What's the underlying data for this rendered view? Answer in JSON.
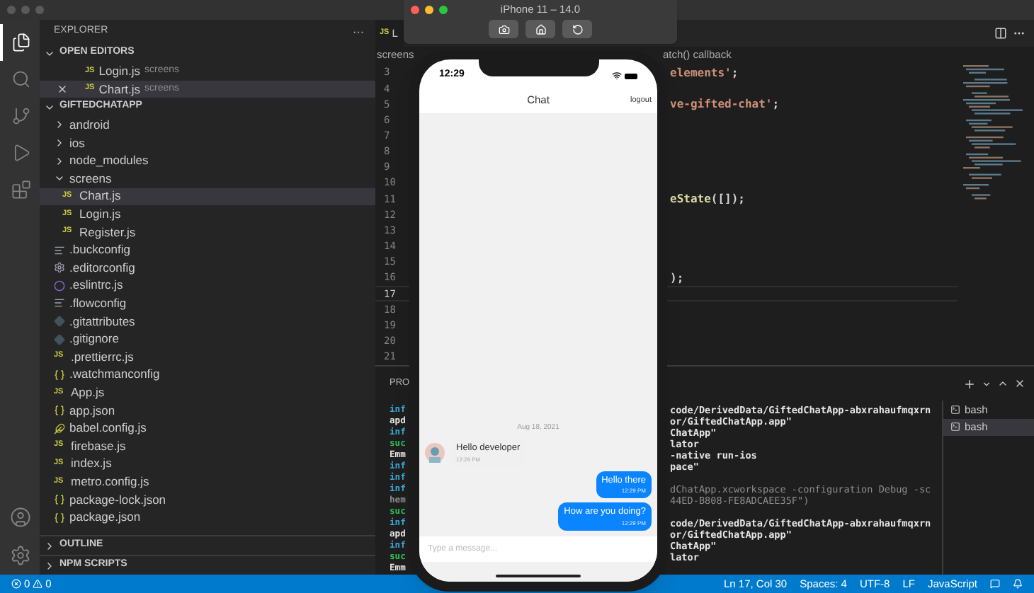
{
  "activity_bar": {
    "items": [
      {
        "kind": "files",
        "selected": true
      },
      {
        "kind": "search",
        "selected": false
      },
      {
        "kind": "git",
        "selected": false
      },
      {
        "kind": "run",
        "selected": false
      },
      {
        "kind": "extensions",
        "selected": false
      }
    ]
  },
  "sidebar": {
    "title": "EXPLORER",
    "more": "···",
    "open_editors": {
      "title": "OPEN EDITORS",
      "expanded": true,
      "items": [
        {
          "name": "Login.js",
          "folder": "screens",
          "icon_text": "JS",
          "selected": false
        },
        {
          "name": "Chart.js",
          "folder": "screens",
          "icon_text": "JS",
          "selected": true
        }
      ]
    },
    "project": {
      "title": "GIFTEDCHATAPP",
      "expanded": true,
      "tree": [
        {
          "name": "android",
          "kind": "folder",
          "expanded": false,
          "selected": false
        },
        {
          "name": "ios",
          "kind": "folder",
          "expanded": false,
          "selected": false
        },
        {
          "name": "node_modules",
          "kind": "folder",
          "expanded": false,
          "selected": false
        },
        {
          "name": "screens",
          "kind": "folder",
          "expanded": true,
          "selected": false,
          "children": [
            {
              "name": "Chart.js",
              "kind": "js",
              "icon_text": "JS",
              "selected": true
            },
            {
              "name": "Login.js",
              "kind": "js",
              "icon_text": "JS",
              "selected": false
            },
            {
              "name": "Register.js",
              "kind": "js",
              "icon_text": "JS",
              "selected": false
            }
          ]
        },
        {
          "name": ".buckconfig",
          "kind": "config",
          "selected": false
        },
        {
          "name": ".editorconfig",
          "kind": "gear",
          "selected": false
        },
        {
          "name": ".eslintrc.js",
          "kind": "eslint",
          "selected": false
        },
        {
          "name": ".flowconfig",
          "kind": "config",
          "selected": false
        },
        {
          "name": ".gitattributes",
          "kind": "git",
          "selected": false
        },
        {
          "name": ".gitignore",
          "kind": "git",
          "selected": false
        },
        {
          "name": ".prettierrc.js",
          "kind": "js",
          "icon_text": "JS",
          "selected": false
        },
        {
          "name": ".watchmanconfig",
          "kind": "json",
          "selected": false
        },
        {
          "name": "App.js",
          "kind": "js",
          "icon_text": "JS",
          "selected": false
        },
        {
          "name": "app.json",
          "kind": "json",
          "selected": false
        },
        {
          "name": "babel.config.js",
          "kind": "babel",
          "selected": false
        },
        {
          "name": "firebase.js",
          "kind": "js",
          "icon_text": "JS",
          "selected": false
        },
        {
          "name": "index.js",
          "kind": "js",
          "icon_text": "JS",
          "selected": false
        },
        {
          "name": "metro.config.js",
          "kind": "js",
          "icon_text": "JS",
          "selected": false
        },
        {
          "name": "package-lock.json",
          "kind": "json",
          "selected": false
        },
        {
          "name": "package.json",
          "kind": "json",
          "selected": false
        }
      ]
    },
    "bottom_sections": [
      {
        "title": "OUTLINE",
        "expanded": false
      },
      {
        "title": "NPM SCRIPTS",
        "expanded": false
      }
    ]
  },
  "editor": {
    "tab": {
      "icon_text": "JS",
      "label": "L"
    },
    "breadcrumb": {
      "start": "screens",
      "end": "atch() callback"
    },
    "lines": [
      {
        "number": "3",
        "current": false,
        "tokens": [
          {
            "text": "elements'",
            "kind": "string"
          },
          {
            "text": ";",
            "kind": "plain"
          }
        ]
      },
      {
        "number": "4",
        "current": false
      },
      {
        "number": "5",
        "current": false,
        "tokens": [
          {
            "text": "ve-gifted-chat'",
            "kind": "string"
          },
          {
            "text": ";",
            "kind": "plain"
          }
        ]
      },
      {
        "number": "6",
        "current": false
      },
      {
        "number": "7",
        "current": false
      },
      {
        "number": "8",
        "current": false
      },
      {
        "number": "9",
        "current": false
      },
      {
        "number": "10",
        "current": false
      },
      {
        "number": "11",
        "current": false,
        "tokens": [
          {
            "text": "eState",
            "kind": "function"
          },
          {
            "text": "([]);",
            "kind": "plain"
          }
        ]
      },
      {
        "number": "12",
        "current": false
      },
      {
        "number": "13",
        "current": false
      },
      {
        "number": "14",
        "current": false
      },
      {
        "number": "15",
        "current": false
      },
      {
        "number": "16",
        "current": false,
        "tokens": [
          {
            "text": ");",
            "kind": "plain"
          }
        ]
      },
      {
        "number": "17",
        "current": true
      },
      {
        "number": "18",
        "current": false
      },
      {
        "number": "19",
        "current": false
      },
      {
        "number": "20",
        "current": false
      },
      {
        "number": "21",
        "current": false
      }
    ]
  },
  "panel": {
    "tab": "PRO",
    "terminal": [
      {
        "left": "inf",
        "kind": "info",
        "right": "code/DerivedData/GiftedChatApp-abxrahaufmqxrn",
        "dim": false
      },
      {
        "left": "apd",
        "kind": "plain",
        "right": "or/GiftedChatApp.app\"",
        "dim": false
      },
      {
        "left": "inf",
        "kind": "info",
        "right": "ChatApp\"",
        "dim": false
      },
      {
        "left": "suc",
        "kind": "success",
        "right": "lator",
        "dim": false
      },
      {
        "left": "Emm",
        "kind": "plain",
        "right": "-native run-ios",
        "dim": false
      },
      {
        "left": "inf",
        "kind": "info",
        "right": "pace\"",
        "dim": false
      },
      {
        "left": "inf",
        "kind": "info"
      },
      {
        "left": "inf",
        "kind": "info",
        "right": "dChatApp.xcworkspace -configuration Debug -sc",
        "dim": true
      },
      {
        "left": "hem",
        "kind": "muted",
        "right": "44ED-B808-FE8ADCAEE35F\")",
        "dim": true
      },
      {
        "left": "suc",
        "kind": "success"
      },
      {
        "left": "inf",
        "kind": "info",
        "right": "code/DerivedData/GiftedChatApp-abxrahaufmqxrn",
        "dim": false
      },
      {
        "left": "apd",
        "kind": "plain",
        "right": "or/GiftedChatApp.app\"",
        "dim": false
      },
      {
        "left": "inf",
        "kind": "info",
        "right": "ChatApp\"",
        "dim": false
      },
      {
        "left": "suc",
        "kind": "success",
        "right": "lator",
        "dim": false
      },
      {
        "left": "Emm",
        "kind": "plain"
      }
    ],
    "shells": [
      {
        "label": "bash",
        "selected": false
      },
      {
        "label": "bash",
        "selected": true
      }
    ]
  },
  "status_bar": {
    "errors": "0",
    "warnings": "0",
    "items": [
      "Ln 17, Col 30",
      "Spaces: 4",
      "UTF-8",
      "LF",
      "JavaScript"
    ]
  },
  "simulator": {
    "title": "iPhone 11 – 14.0",
    "phone": {
      "time": "12:29",
      "header": {
        "title": "Chat",
        "action": "logout"
      },
      "date": "Aug 18, 2021",
      "messages": [
        {
          "kind": "incoming",
          "text": "Hello developer",
          "time": "12:29 PM"
        },
        {
          "kind": "outgoing",
          "text": "Hello there",
          "time": "12:29 PM"
        },
        {
          "kind": "outgoing",
          "text": "How are you doing?",
          "time": "12:29 PM"
        }
      ],
      "composer": {
        "placeholder": "Type a message..."
      }
    }
  }
}
